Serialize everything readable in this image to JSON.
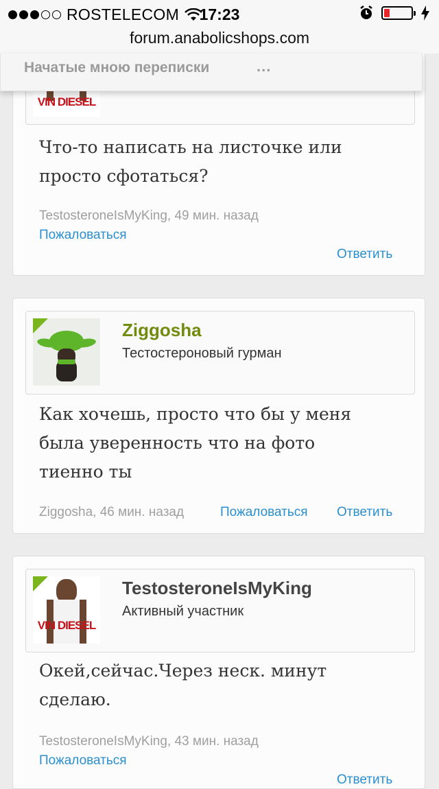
{
  "status_bar": {
    "carrier": "ROSTELECOM",
    "time": "17:23",
    "signal_bars_filled": 3,
    "signal_bars_total": 5,
    "battery_level": 0.2,
    "battery_color": "#e8262b",
    "icons": [
      "wifi-icon",
      "alarm-icon",
      "battery-icon",
      "charging-bolt-icon"
    ]
  },
  "browser": {
    "url": "forum.anabolicshops.com"
  },
  "nav": {
    "conversations_label": "Начатые мною переписки",
    "more_label": "..."
  },
  "colors": {
    "accent_link": "#2a8fd0",
    "username_green": "#6f8c0e",
    "badge_green": "#7ab51d"
  },
  "posts": [
    {
      "avatar": "vin-diesel-avatar",
      "avatar_logo": "VIN DIESEL",
      "message_lines": [
        "Что-то написать на листочке или",
        "просто сфотаться?"
      ],
      "meta": "TestosteroneIsMyKing, 49 мин. назад",
      "report_label": "Пожаловаться",
      "reply_label": "Ответить"
    },
    {
      "avatar": "yoda-dog-avatar",
      "username": "Ziggosha",
      "user_title": "Тестостероновый гурман",
      "message_lines": [
        "Как хочешь, просто что бы у меня",
        "была уверенность что на фото",
        "тиенно ты"
      ],
      "meta": "Ziggosha, 46 мин. назад",
      "report_label": "Пожаловаться",
      "reply_label": "Ответить"
    },
    {
      "avatar": "vin-diesel-avatar",
      "avatar_logo": "VIN DIESEL",
      "username": "TestosteroneIsMyKing",
      "user_title": "Активный участник",
      "message_lines": [
        "Окей,сейчас.Через неск. минут",
        "сделаю."
      ],
      "meta": "TestosteroneIsMyKing, 43 мин. назад",
      "report_label": "Пожаловаться",
      "reply_label": "Ответить"
    }
  ]
}
